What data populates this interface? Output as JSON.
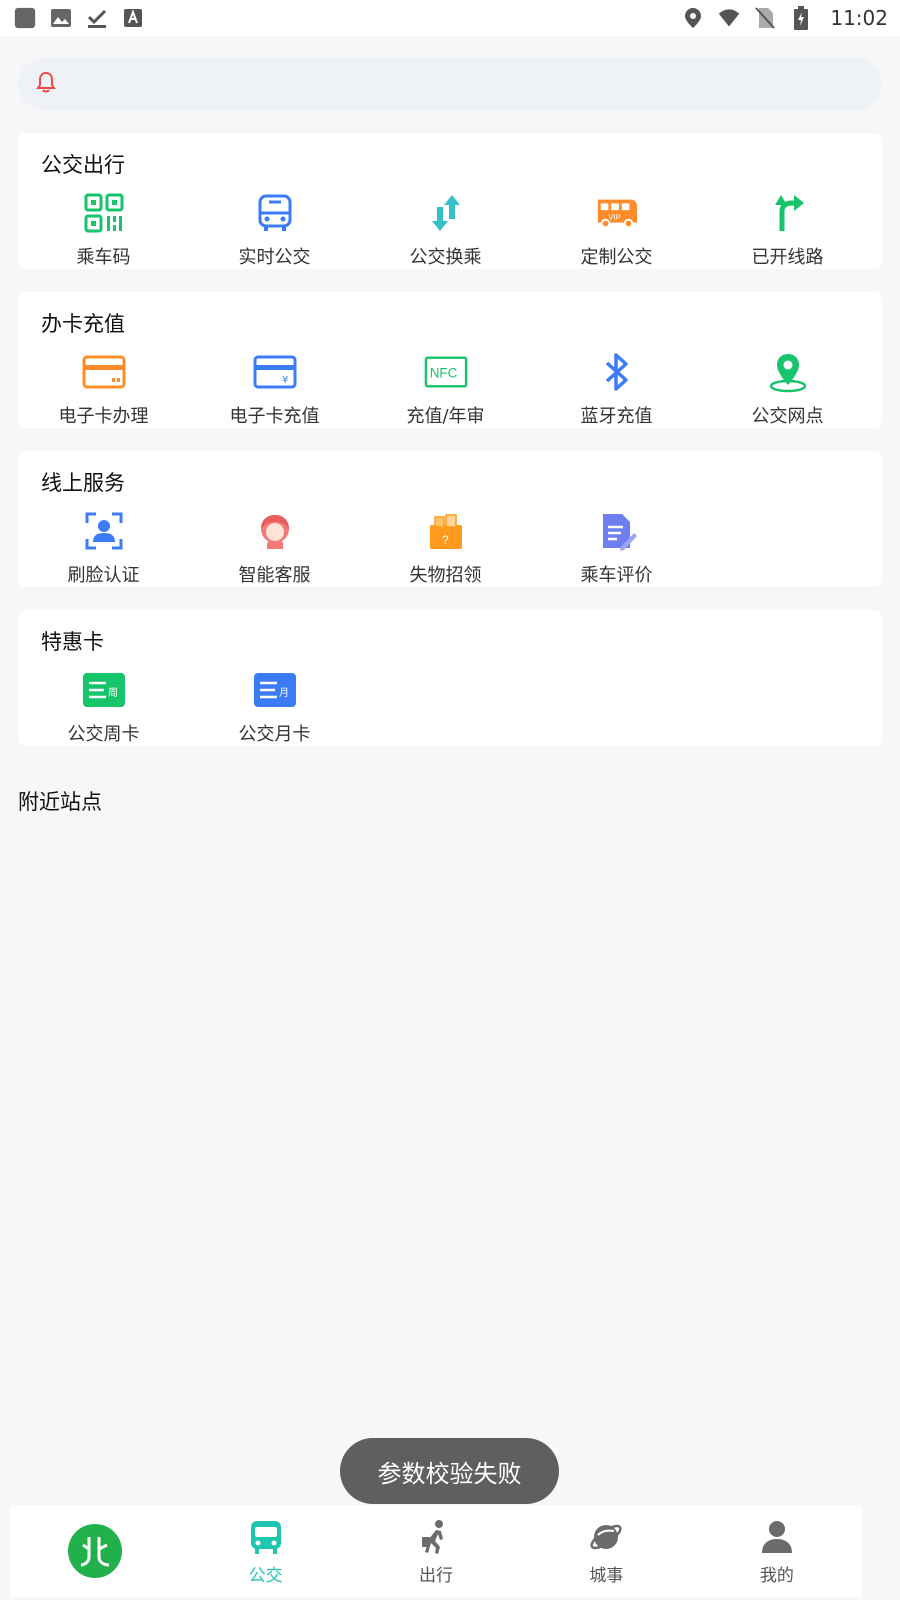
{
  "status_bar": {
    "time": "11:02",
    "left_icons": [
      "app-icon",
      "image-icon",
      "download-done-icon",
      "font-icon"
    ],
    "right_icons": [
      "location-icon",
      "wifi-icon",
      "no-sim-icon",
      "battery-charging-icon"
    ]
  },
  "notice": {
    "icon": "bell-icon",
    "text": ""
  },
  "sections": [
    {
      "title": "公交出行",
      "items": [
        {
          "label": "乘车码",
          "icon": "qr-code-icon"
        },
        {
          "label": "实时公交",
          "icon": "bus-icon"
        },
        {
          "label": "公交换乘",
          "icon": "transfer-arrows-icon"
        },
        {
          "label": "定制公交",
          "icon": "vip-bus-icon"
        },
        {
          "label": "已开线路",
          "icon": "route-arrow-icon"
        }
      ]
    },
    {
      "title": "办卡充值",
      "items": [
        {
          "label": "电子卡办理",
          "icon": "card-icon"
        },
        {
          "label": "电子卡充值",
          "icon": "card-yen-icon"
        },
        {
          "label": "充值/年审",
          "icon": "nfc-icon"
        },
        {
          "label": "蓝牙充值",
          "icon": "bluetooth-icon"
        },
        {
          "label": "公交网点",
          "icon": "map-pin-icon"
        }
      ]
    },
    {
      "title": "线上服务",
      "items": [
        {
          "label": "刷脸认证",
          "icon": "face-scan-icon"
        },
        {
          "label": "智能客服",
          "icon": "customer-service-icon"
        },
        {
          "label": "失物招领",
          "icon": "lost-found-icon"
        },
        {
          "label": "乘车评价",
          "icon": "review-document-icon"
        }
      ]
    },
    {
      "title": "特惠卡",
      "items": [
        {
          "label": "公交周卡",
          "icon": "weekly-card-icon",
          "badge": "周"
        },
        {
          "label": "公交月卡",
          "icon": "monthly-card-icon",
          "badge": "月"
        }
      ]
    }
  ],
  "nearby": {
    "title": "附近站点"
  },
  "toast": {
    "text": "参数校验失败"
  },
  "bottom_nav": {
    "items": [
      {
        "label": "",
        "icon": "app-logo-icon"
      },
      {
        "label": "公交",
        "icon": "bus-nav-icon",
        "active": true
      },
      {
        "label": "出行",
        "icon": "walking-traveler-icon"
      },
      {
        "label": "城事",
        "icon": "planet-icon"
      },
      {
        "label": "我的",
        "icon": "person-icon"
      }
    ]
  },
  "colors": {
    "green": "#16c46b",
    "blue": "#3b7cf6",
    "orange": "#ff8c2a",
    "teal": "#33c1c9",
    "active_teal": "#1ec6b0",
    "bell_red": "#f04848"
  }
}
